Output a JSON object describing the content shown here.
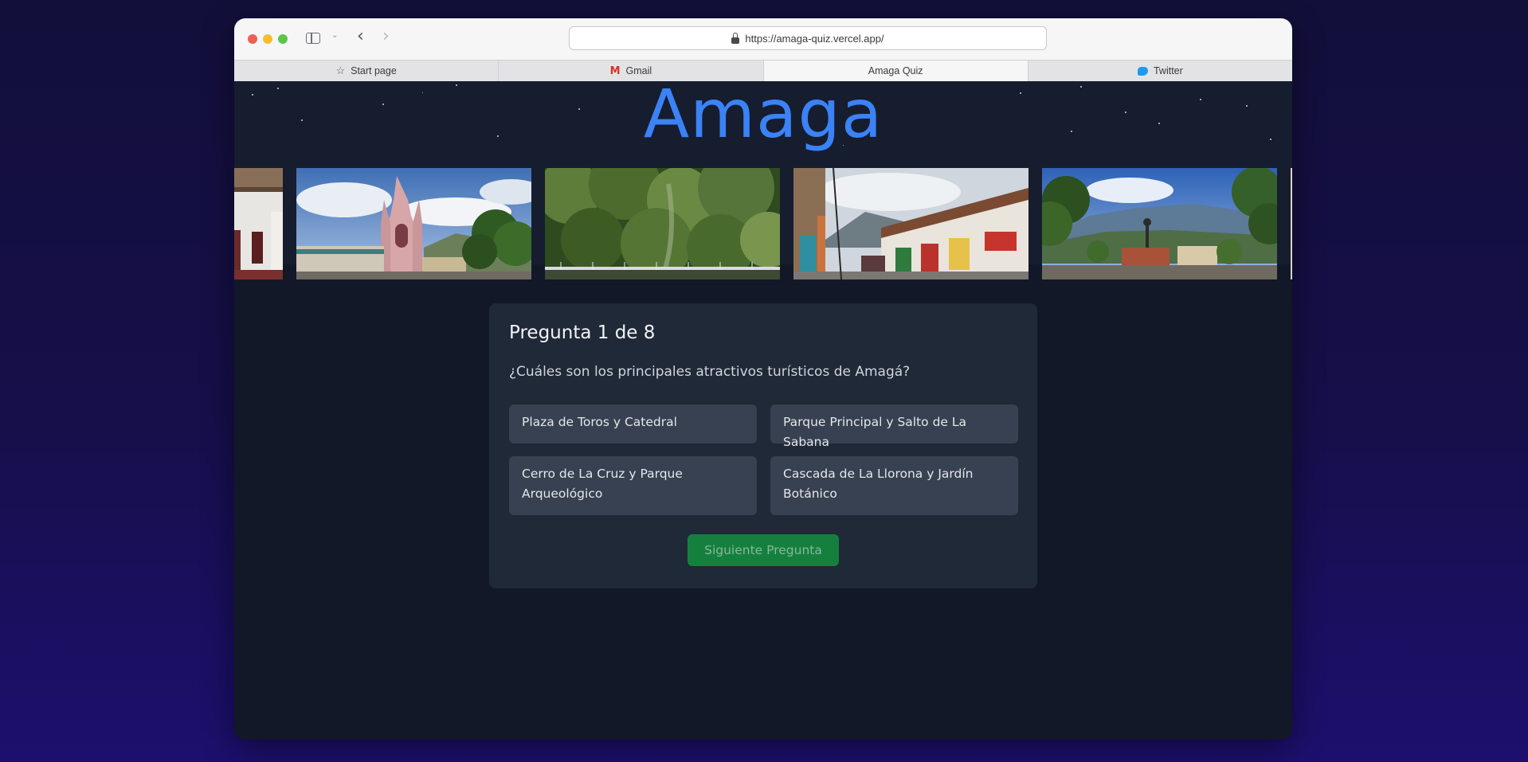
{
  "browser": {
    "url": "https://amaga-quiz.vercel.app/",
    "tabs": [
      {
        "label": "Start page",
        "icon": "star-icon"
      },
      {
        "label": "Gmail",
        "icon": "gmail-icon"
      },
      {
        "label": "Amaga Quiz",
        "icon": ""
      },
      {
        "label": "Twitter",
        "icon": "twitter-icon"
      }
    ],
    "active_tab": 2
  },
  "site": {
    "title": "Amaga",
    "title_color": "#3b82f6"
  },
  "gallery": {
    "photos": [
      "white-colonial-house",
      "gothic-church-plaza",
      "jungle-waterfall-bridge",
      "colorful-street-houses",
      "main-park-mountains",
      "white-building-edge"
    ]
  },
  "quiz": {
    "counter": "Pregunta 1 de 8",
    "question": "¿Cuáles son los principales atractivos turísticos de Amagá?",
    "options": [
      "Plaza de Toros y Catedral",
      "Parque Principal y Salto de La Sabana",
      "Cerro de La Cruz y Parque Arqueológico",
      "Cascada de La Llorona y Jardín Botánico"
    ],
    "next_label": "Siguiente Pregunta",
    "next_enabled": false
  },
  "colors": {
    "card_bg": "#1f2937",
    "option_bg": "#374151",
    "button_bg": "#15803d",
    "page_bg": "#121827"
  }
}
